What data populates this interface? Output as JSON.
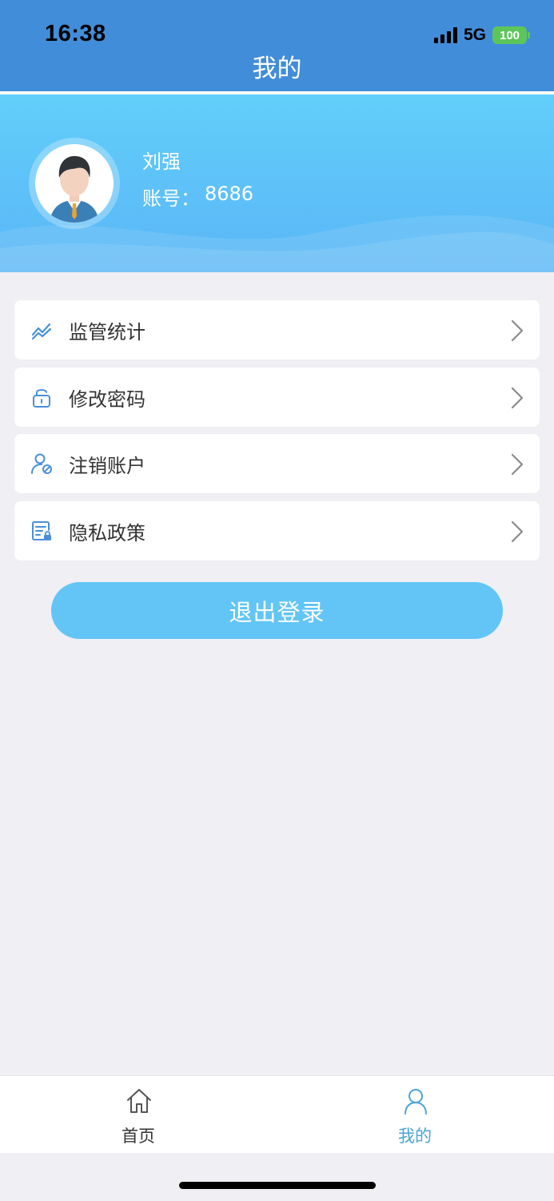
{
  "status_bar": {
    "time": "16:38",
    "network": "5G",
    "battery": "100"
  },
  "nav": {
    "title": "我的"
  },
  "profile": {
    "name": "刘强",
    "account_label": "账号：",
    "account_value": "8686"
  },
  "menu": [
    {
      "label": "监管统计",
      "icon": "trend-chart-icon"
    },
    {
      "label": "修改密码",
      "icon": "unlock-icon"
    },
    {
      "label": "注销账户",
      "icon": "user-cancel-icon"
    },
    {
      "label": "隐私政策",
      "icon": "privacy-document-icon"
    }
  ],
  "logout": {
    "label": "退出登录"
  },
  "tabbar": {
    "tabs": [
      {
        "label": "首页",
        "icon": "home-icon",
        "active": false
      },
      {
        "label": "我的",
        "icon": "user-icon",
        "active": true
      }
    ]
  },
  "colors": {
    "header": "#428dd9",
    "banner": "#5ab6f6",
    "accent": "#62c5f6",
    "icon": "#4a90d9",
    "background": "#efeff4",
    "tab_active": "#4aa3d9",
    "tab_inactive": "#333333"
  }
}
